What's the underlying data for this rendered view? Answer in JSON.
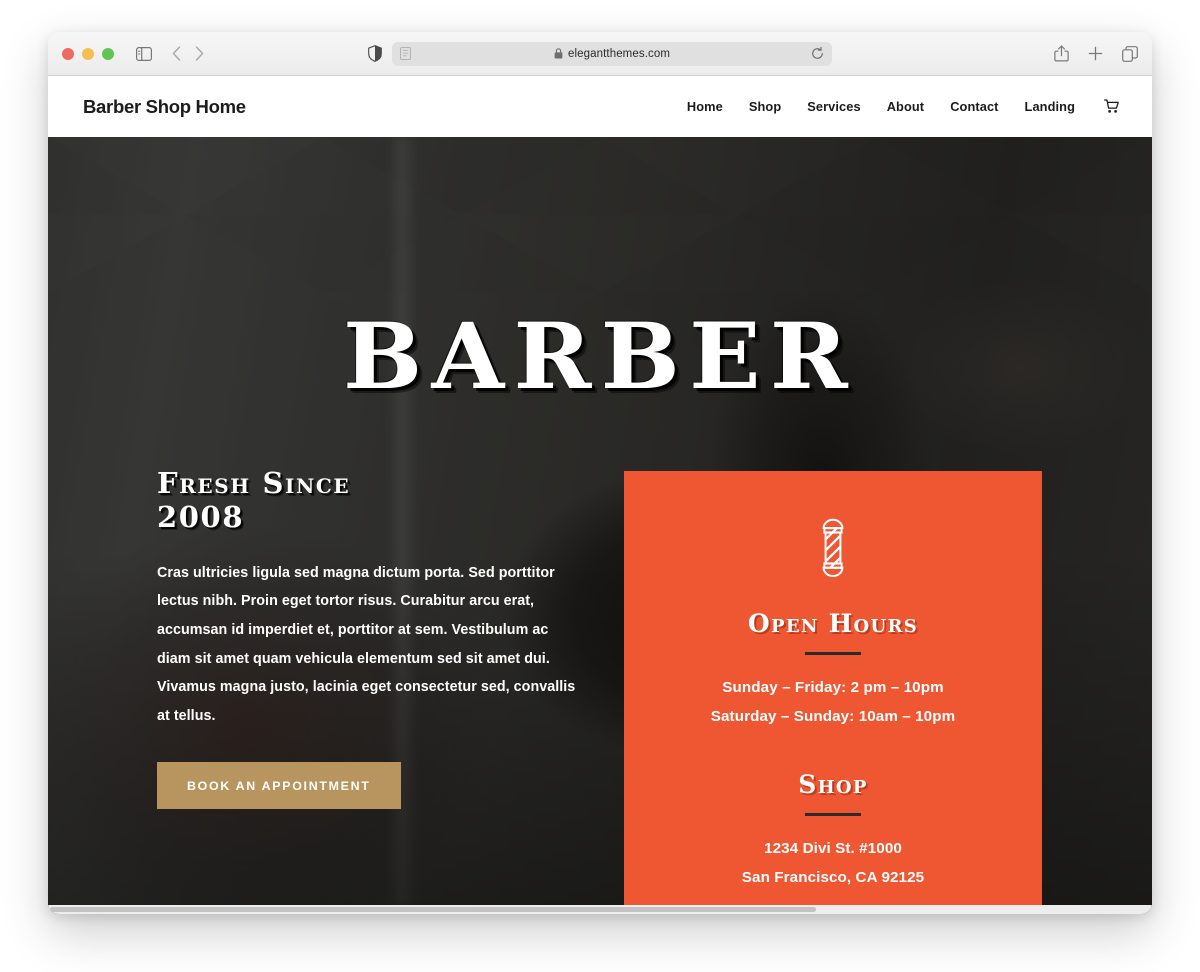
{
  "browser": {
    "name": "safari",
    "traffic_lights": [
      {
        "name": "close",
        "color": "#ec6a5f"
      },
      {
        "name": "minimize",
        "color": "#f5bf4f"
      },
      {
        "name": "zoom",
        "color": "#61c555"
      }
    ],
    "toolbar_left_icons": [
      "sidebar-icon",
      "back-arrow-icon",
      "forward-arrow-icon"
    ],
    "privacy_icon": "shield-icon",
    "address_bar": {
      "reader_icon": "reader-mode-icon",
      "lock_icon": "lock-icon",
      "url": "elegantthemes.com",
      "reload_icon": "reload-icon"
    },
    "toolbar_right_icons": [
      "share-icon",
      "new-tab-icon",
      "tab-overview-icon"
    ]
  },
  "site": {
    "brand": "Barber Shop Home",
    "nav": [
      {
        "label": "Home"
      },
      {
        "label": "Shop"
      },
      {
        "label": "Services"
      },
      {
        "label": "About"
      },
      {
        "label": "Contact"
      },
      {
        "label": "Landing"
      }
    ],
    "cart_icon": "shopping-cart-icon"
  },
  "hero": {
    "title": "BARBER",
    "subheading_line1": "Fresh Since",
    "subheading_line2": "2008",
    "body": "Cras ultricies ligula sed magna dictum porta. Sed porttitor lectus nibh. Proin eget tortor risus. Curabitur arcu erat, accumsan id imperdiet et, porttitor at sem. Vestibulum ac diam sit amet quam vehicula elementum sed sit amet dui. Vivamus magna justo, lacinia eget consectetur sed, convallis at tellus.",
    "cta_label": "BOOK AN APPOINTMENT"
  },
  "info_card": {
    "background_color": "#ef5632",
    "icon": "barber-pole-icon",
    "hours_heading": "Open Hours",
    "hours": [
      "Sunday – Friday: 2 pm – 10pm",
      "Saturday – Sunday: 10am – 10pm"
    ],
    "shop_heading": "Shop",
    "address": [
      "1234 Divi St. #1000",
      "San Francisco, CA 92125"
    ]
  },
  "colors": {
    "accent_orange": "#ef5632",
    "cta_gold": "#b8945f",
    "header_white": "#ffffff",
    "hero_dark": "#2e2e2e"
  }
}
